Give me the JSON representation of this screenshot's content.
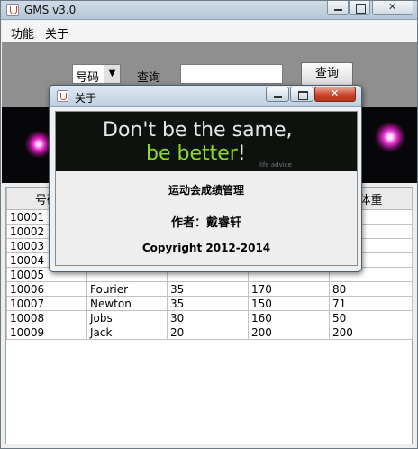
{
  "window": {
    "title": "GMS v3.0"
  },
  "menu": {
    "items": [
      "功能",
      "关于"
    ]
  },
  "toolbar": {
    "search_field_selected": "号码",
    "query_label": "查询",
    "query_value": "",
    "query_button": "查询"
  },
  "table": {
    "columns": [
      "号码",
      "",
      "",
      "",
      "体重"
    ],
    "rows": [
      [
        "10001",
        "",
        "",
        "",
        ""
      ],
      [
        "10002",
        "",
        "",
        "",
        ""
      ],
      [
        "10003",
        "",
        "",
        "",
        ""
      ],
      [
        "10004",
        "",
        "",
        "",
        ""
      ],
      [
        "10005",
        "",
        "",
        "",
        ""
      ],
      [
        "10006",
        "Fourier",
        "35",
        "170",
        "80"
      ],
      [
        "10007",
        "Newton",
        "35",
        "150",
        "71"
      ],
      [
        "10008",
        "Jobs",
        "30",
        "160",
        "50"
      ],
      [
        "10009",
        "Jack",
        "20",
        "200",
        "200"
      ]
    ]
  },
  "dialog": {
    "title": "关于",
    "slogan_line1": "Don't be the same,",
    "slogan_line2_green": "be better",
    "slogan_line2_rest": "!",
    "slogan_small": "life advice",
    "app_name": "运动会成绩管理",
    "author": "作者：戴睿轩",
    "copyright": "Copyright 2012-2014"
  },
  "colors": {
    "accent_green": "#8bdc2e",
    "close_red": "#c9442a",
    "banner_bg": "#07070a"
  }
}
